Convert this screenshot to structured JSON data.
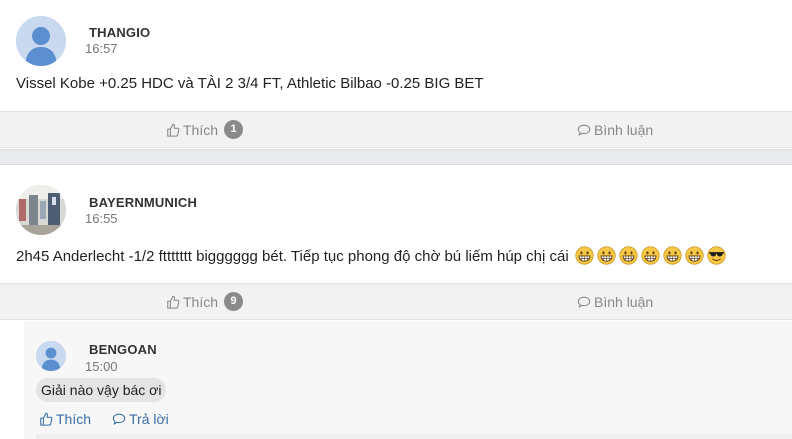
{
  "posts": [
    {
      "username": "THANGIO",
      "time": "16:57",
      "content": "Vissel Kobe +0.25 HDC và TÀI 2 3/4 FT, Athletic Bilbao -0.25 BIG BET",
      "like_label": "Thích",
      "like_count": "1",
      "comment_label": "Bình luận"
    },
    {
      "username": "BAYERNMUNICH",
      "time": "16:55",
      "content": "2h45 Anderlecht -1/2 fttttttt bigggggg bét. Tiếp tục phong độ chờ bú liếm húp chị cái",
      "emojis": [
        "grin-emoji",
        "grin-emoji",
        "grin-emoji",
        "grin-emoji",
        "grin-emoji",
        "grin-emoji",
        "sunglasses-emoji"
      ],
      "like_label": "Thích",
      "like_count": "9",
      "comment_label": "Bình luận",
      "reply": {
        "username": "BENGOAN",
        "time": "15:00",
        "content": "Giải nào vậy bác ơi",
        "like_label": "Thích",
        "reply_label": "Trả lời"
      }
    }
  ],
  "colors": {
    "background": "#e9ebee",
    "action_bar": "#f2f2f2",
    "badge": "#8a8a8a",
    "link": "#3a6ea5"
  }
}
